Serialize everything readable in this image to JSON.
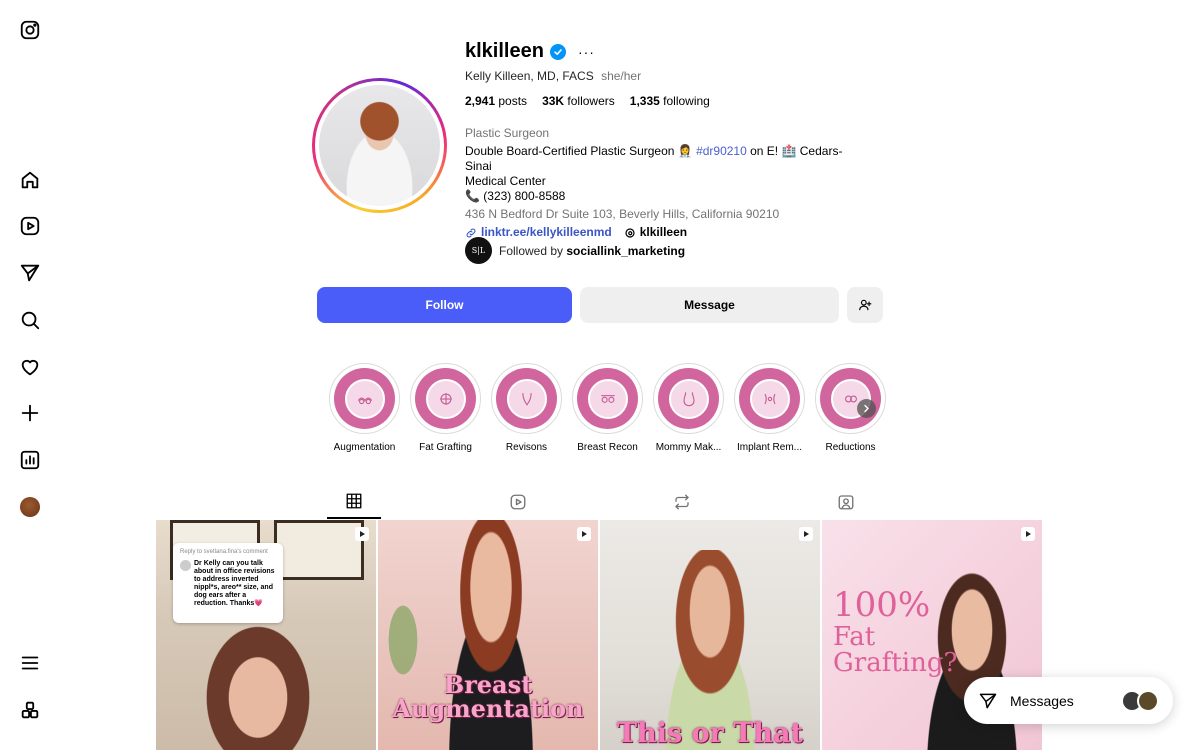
{
  "profile": {
    "username": "klkilleen",
    "full_name": "Kelly Killeen, MD, FACS",
    "pronouns": "she/her",
    "posts_count": "2,941",
    "posts_label": "posts",
    "followers_count": "33K",
    "followers_label": "followers",
    "following_count": "1,335",
    "following_label": "following"
  },
  "bio": {
    "category": "Plastic Surgeon",
    "line1_a": "Double Board-Certified Plastic Surgeon 👩‍⚕️",
    "hashtag": "#dr90210",
    "line1_b": "on E! 🏥 Cedars-Sinai",
    "line2": "Medical Center",
    "phone": "📞 (323) 800-8588",
    "address": "436 N Bedford Dr Suite 103, Beverly Hills, California 90210",
    "link": "linktr.ee/kellykilleenmd",
    "threads": "klkilleen"
  },
  "followed_by": {
    "avatar_text": "S|L",
    "prefix": "Followed by",
    "account": "sociallink_marketing"
  },
  "buttons": {
    "follow": "Follow",
    "message": "Message"
  },
  "highlights": [
    {
      "label": "Augmentation"
    },
    {
      "label": "Fat Grafting"
    },
    {
      "label": "Revisons"
    },
    {
      "label": "Breast Recon"
    },
    {
      "label": "Mommy Mak..."
    },
    {
      "label": "Implant Rem..."
    },
    {
      "label": "Reductions"
    }
  ],
  "posts": {
    "post1": {
      "reply": "Reply to svetlana.fina's comment",
      "comment": "Dr Kelly can you talk about in office revisions to address inverted nippl*s, areo** size, and dog ears after a reduction. Thanks💗"
    },
    "post2": {
      "line1": "Breast",
      "line2": "Augmentation"
    },
    "post3": {
      "line1": "This or That"
    },
    "post4": {
      "line1": "100%",
      "line2": "Fat",
      "line3": "Grafting?"
    }
  },
  "messages": {
    "label": "Messages"
  },
  "colors": {
    "follow_button": "#4a5df9",
    "link": "#3b55c4",
    "highlight": "#d1669f",
    "verified": "#0095f6"
  },
  "icons": {
    "sidebar": [
      "instagram-logo-icon",
      "home-icon",
      "reels-icon",
      "direct-icon",
      "search-icon",
      "heart-icon",
      "create-icon",
      "dashboard-icon",
      "profile-avatar",
      "menu-icon",
      "apps-icon"
    ],
    "tabs": [
      "grid-icon",
      "reels-icon",
      "reposts-icon",
      "tagged-icon"
    ]
  }
}
